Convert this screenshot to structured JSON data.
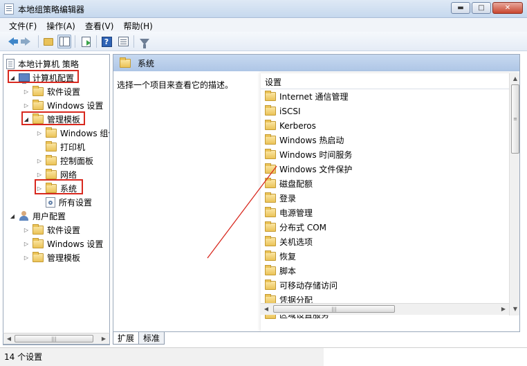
{
  "window": {
    "title": "本地组策略编辑器",
    "controls": {
      "minimize": "▬",
      "maximize": "□",
      "close": "✕"
    }
  },
  "menubar": [
    "文件(F)",
    "操作(A)",
    "查看(V)",
    "帮助(H)"
  ],
  "toolbar": {
    "icons": [
      "back-icon",
      "forward-icon",
      "up-folder-icon",
      "show-hide-tree-icon",
      "export-list-icon",
      "help-icon",
      "properties-icon",
      "filter-icon"
    ],
    "help_glyph": "?"
  },
  "tree": {
    "root": "本地计算机 策略",
    "computer_config": "计算机配置",
    "computer_children": {
      "software": "软件设置",
      "windows": "Windows 设置",
      "admin_templates": "管理模板",
      "admin_children": [
        "Windows 组件",
        "打印机",
        "控制面板",
        "网络",
        "系统",
        "所有设置"
      ]
    },
    "user_config": "用户配置",
    "user_children": [
      "软件设置",
      "Windows 设置",
      "管理模板"
    ]
  },
  "content": {
    "header": "系统",
    "description": "选择一个项目来查看它的描述。",
    "column_header": "设置",
    "items": [
      "Internet 通信管理",
      "iSCSI",
      "Kerberos",
      "Windows 热启动",
      "Windows 时间服务",
      "Windows 文件保护",
      "磁盘配额",
      "登录",
      "电源管理",
      "分布式 COM",
      "关机选项",
      "恢复",
      "脚本",
      "可移动存储访问",
      "凭据分配",
      "区域设置服务"
    ]
  },
  "tabs": [
    "扩展",
    "标准"
  ],
  "status": {
    "text": "14 个设置"
  },
  "colors": {
    "highlight_box": "#d8281e",
    "annotation_line": "#d8281e",
    "header_bg": "#b8cdeb"
  }
}
